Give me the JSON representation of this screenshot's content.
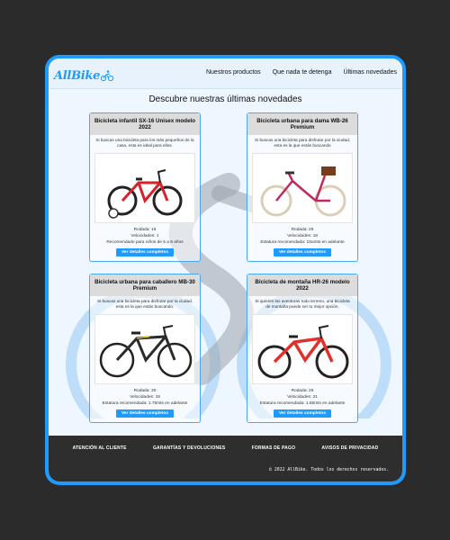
{
  "brand": {
    "logo_text": "AllBike",
    "accent": "#1e9bff"
  },
  "nav": {
    "items": [
      "Nuestros productos",
      "Que nada te detenga",
      "Últimas novedades"
    ]
  },
  "main": {
    "title": "Descubre nuestras últimas novedades"
  },
  "products": [
    {
      "name": "Bicicleta infantil SX-16 Unisex modelo 2022",
      "description": "Si buscas una bicicleta para los más pequeños de la casa, esta es ideal para ellos.",
      "specs": [
        "Rodada: 16",
        "Velocidades: 1",
        "Recomendado para niños de 5 a 8 años"
      ],
      "button": "Ver detalles completos",
      "color": "#d8222a"
    },
    {
      "name": "Bicicleta urbana para dama WB-26 Premium",
      "description": "Si buscas una bicicleta para disfrutar por la ciudad, esta es la que estás buscando",
      "specs": [
        "Rodada: 26",
        "Velocidades: 18",
        "Estatura recomendada: 15umts en adelante"
      ],
      "button": "Ver detalles completos",
      "color": "#c2275e"
    },
    {
      "name": "Bicicleta urbana para caballero MB-30 Premium",
      "description": "Si buscas una bicicleta para disfrutar por la ciudad, esta es la que estás buscando.",
      "specs": [
        "Rodada: 30",
        "Velocidades: 18",
        "Estatura recomendada: 1.75mts en adelante"
      ],
      "button": "Ver detalles completos",
      "color": "#2b2b2b"
    },
    {
      "name": "Bicicleta de montaña HR-26 modelo 2022",
      "description": "Si quieres las aventuras todo terreno, una bicicleta de montaña puede ser tu mejor opción.",
      "specs": [
        "Rodada: 26",
        "Velocidades: 21",
        "Estatura recomendada: 1.65mts en adelante"
      ],
      "button": "Ver detalles completos",
      "color": "#e1302a"
    }
  ],
  "footer": {
    "links": [
      "ATENCIÓN AL CLIENTE",
      "GARANTÍAS Y DEVOLUCIONES",
      "FORMAS DE PAGO",
      "AVISOS DE PRIVACIDAD"
    ],
    "copyright": "© 2022 AllBike. Todos los derechos reservados."
  }
}
